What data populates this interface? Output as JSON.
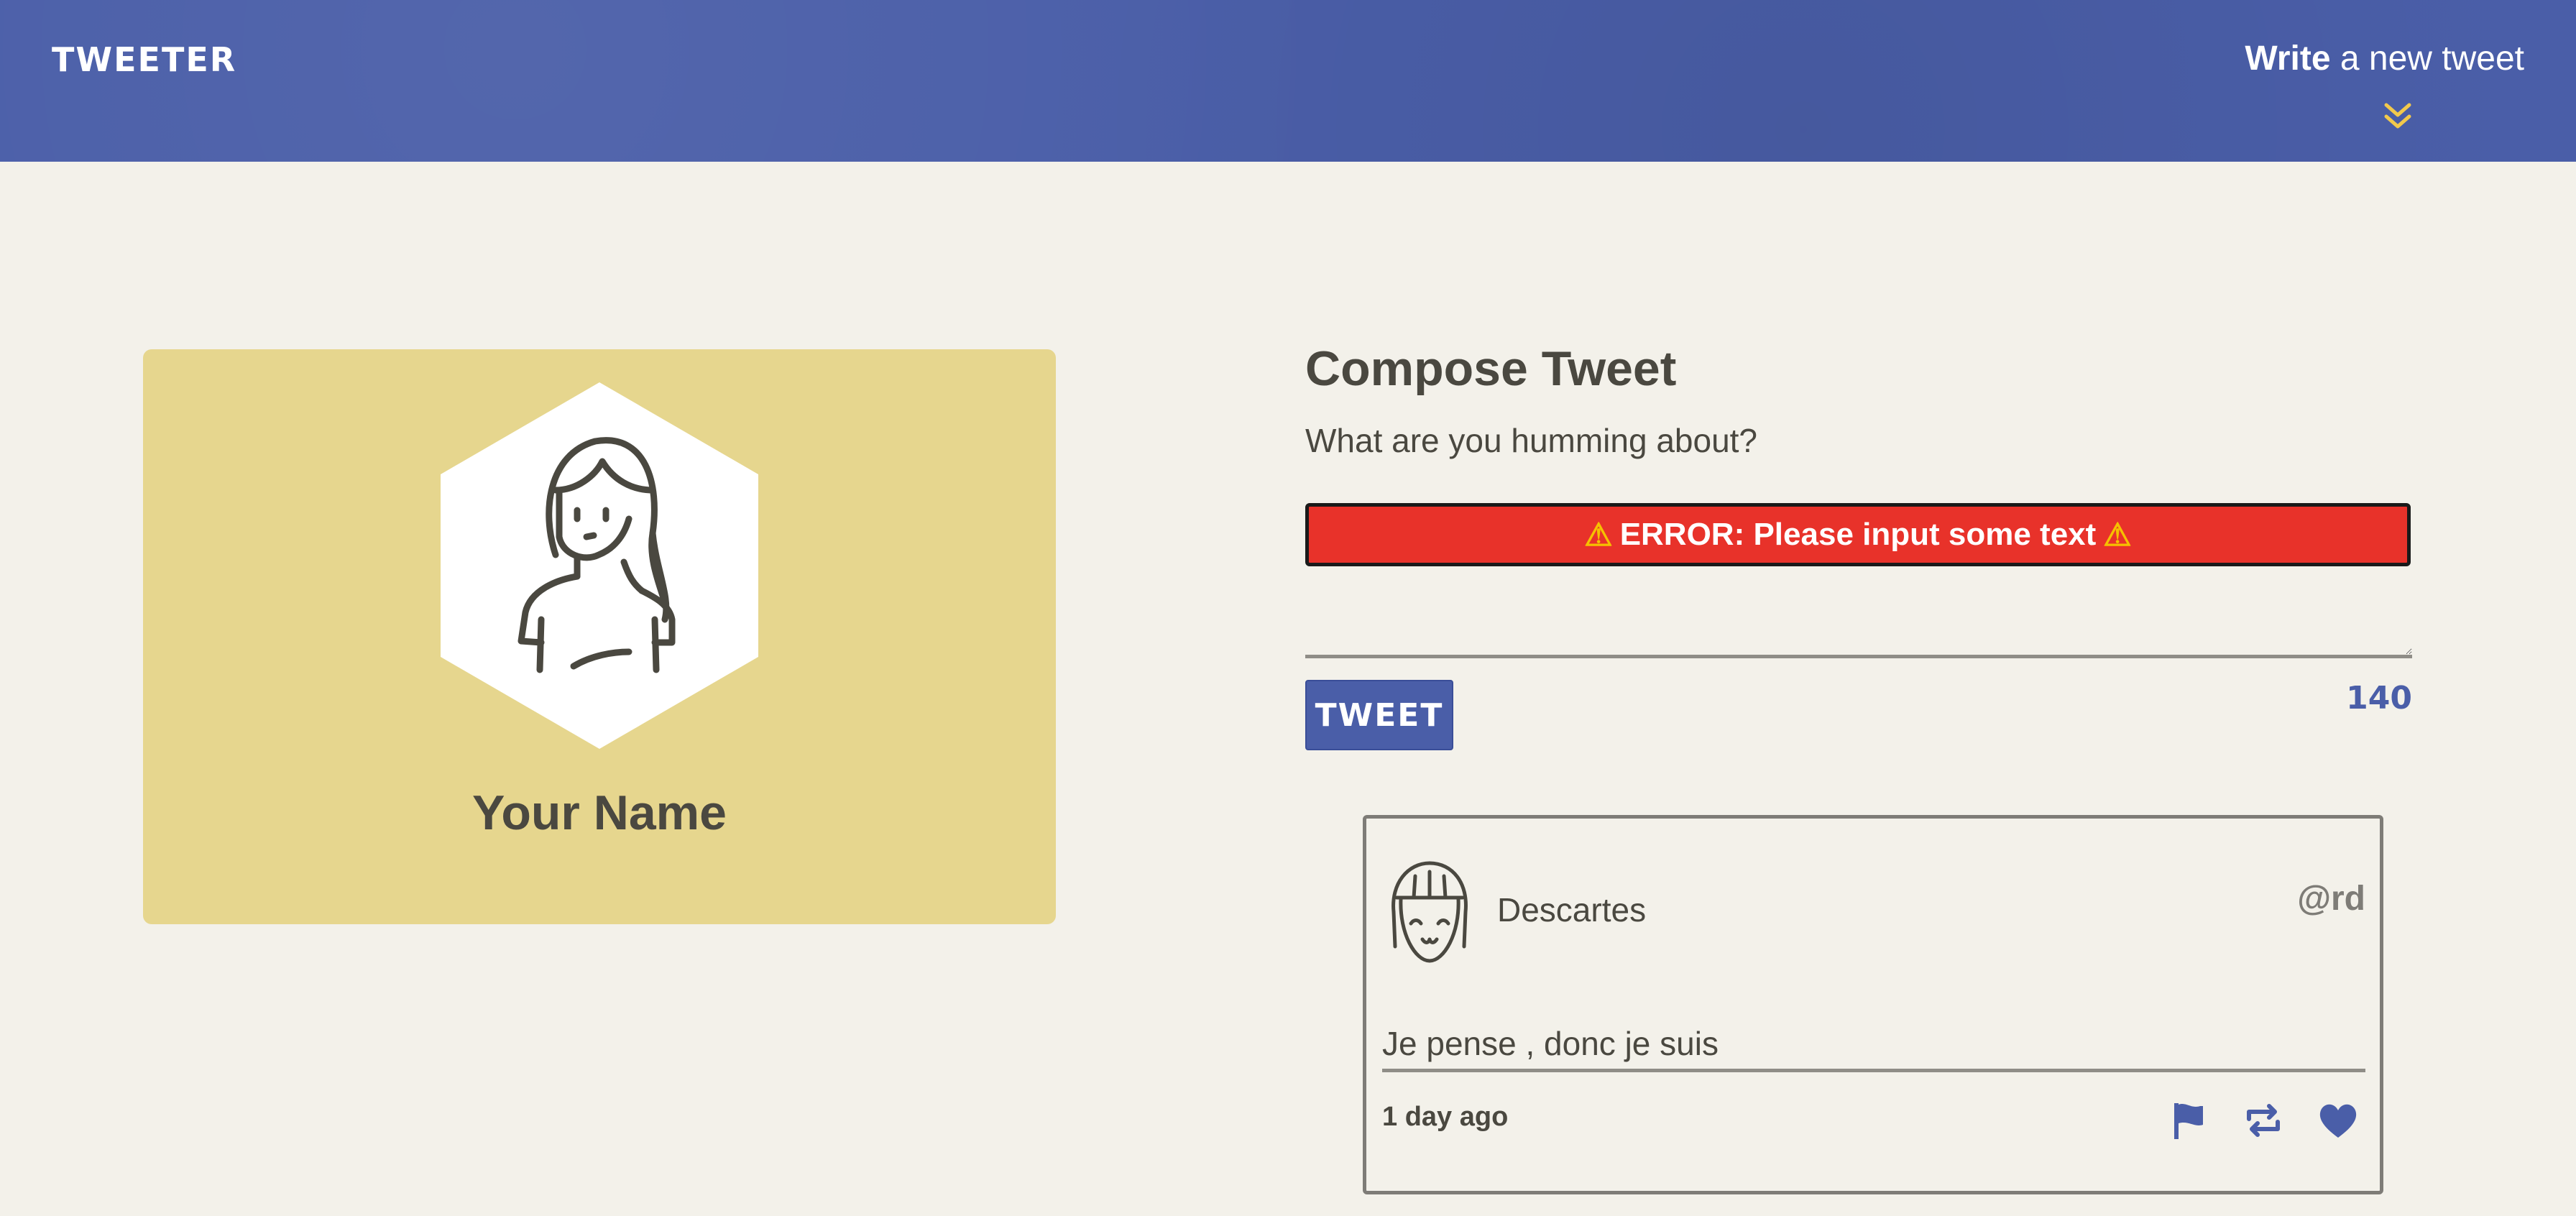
{
  "navbar": {
    "brand": "TWEETER",
    "write_bold": "Write",
    "write_rest": " a new tweet",
    "chevron_icon": "double-chevron-down-icon",
    "accent_color": "#f2c94c"
  },
  "profile": {
    "name": "Your Name",
    "avatar_icon": "user-avatar-icon"
  },
  "compose": {
    "title": "Compose Tweet",
    "subtitle": "What are you humming about?",
    "error_prefix": "⚠",
    "error_text": "ERROR: Please input some text",
    "error_suffix": "⚠",
    "textarea_value": "",
    "button_label": "TWEET",
    "counter": "140"
  },
  "tweet": {
    "author": "Descartes",
    "handle": "@rd",
    "text": "Je pense , donc je suis",
    "time": "1 day ago",
    "actions": [
      "flag-icon",
      "retweet-icon",
      "heart-icon"
    ]
  },
  "colors": {
    "navbar": "#4a5ea8",
    "card": "#e6d68e",
    "error": "#e8322a",
    "text": "#4a4840",
    "background": "#f3f1ea"
  }
}
